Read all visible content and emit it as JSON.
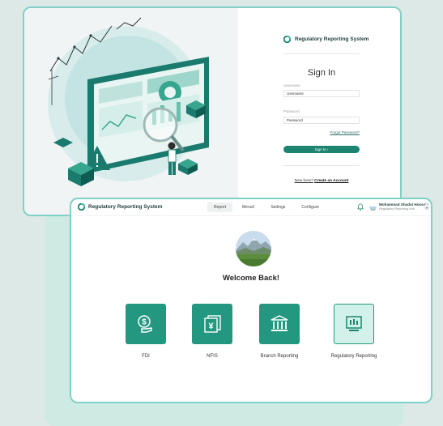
{
  "colors": {
    "accent": "#1c8470",
    "tile": "#23977f",
    "tile_light": "#d2f1ea",
    "window_border": "#7fd0c6",
    "background": "#dde9e6"
  },
  "login": {
    "brand": "Regulatory Reporting System",
    "title": "Sign In",
    "username_label": "Username",
    "username_value": "Username",
    "password_label": "Password",
    "password_value": "Password",
    "forgot": "Forgot Password?",
    "signin_button": "Sign In ›",
    "new_here": "New here?",
    "create_account": "Create an Account"
  },
  "app": {
    "brand": "Regulatory Reporting System",
    "nav": [
      "Report",
      "Menu2",
      "Settings",
      "Configure"
    ],
    "active_nav": "Report",
    "user": {
      "name": "Mohammad Shadat Hossain",
      "role": "Regulatory Reporting Unit"
    },
    "welcome": "Welcome Back!",
    "tiles": [
      {
        "label": "FDI",
        "icon": "hand-dollar-icon"
      },
      {
        "label": "NFIS",
        "icon": "yen-stack-icon"
      },
      {
        "label": "Branch Reporting",
        "icon": "bank-icon"
      },
      {
        "label": "Regulatory Reporting",
        "icon": "dashboard-monitor-icon"
      }
    ]
  }
}
